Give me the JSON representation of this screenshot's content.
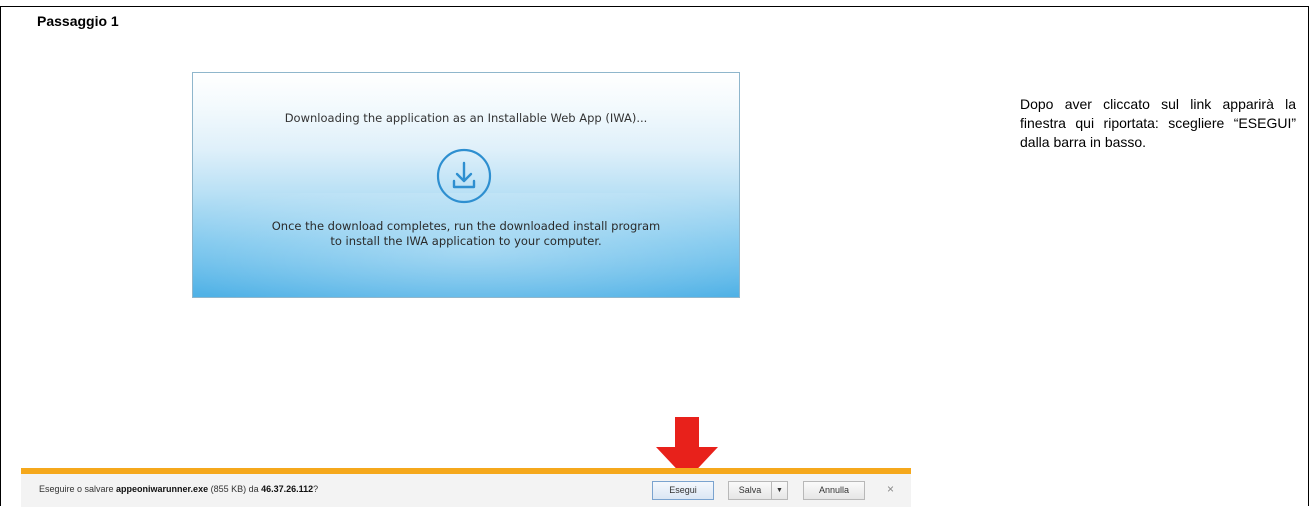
{
  "step": {
    "title": "Passaggio 1"
  },
  "instructions": {
    "text": "Dopo aver cliccato sul link apparirà la finestra qui riportata: scegliere “ESEGUI” dalla barra in basso."
  },
  "iwa_panel": {
    "heading": "Downloading the application as an Installable Web App (IWA)...",
    "message_line1": "Once the download completes, run the downloaded install program",
    "message_line2": "to install the IWA application to your computer.",
    "icon": "download-icon",
    "accent_color": "#2e8fd0"
  },
  "download_bar": {
    "prompt_prefix": "Eseguire o salvare ",
    "file_name": "appeoniwarunner.exe",
    "file_size": " (855 KB) da ",
    "host": "46.37.26.112",
    "prompt_suffix": "?",
    "run_label": "Esegui",
    "save_label": "Salva",
    "save_dropdown": "▼",
    "cancel_label": "Annulla",
    "close_label": "×",
    "accent_color": "#f5a81c"
  },
  "arrow": {
    "icon": "red-down-arrow-icon",
    "color": "#e8211b"
  }
}
